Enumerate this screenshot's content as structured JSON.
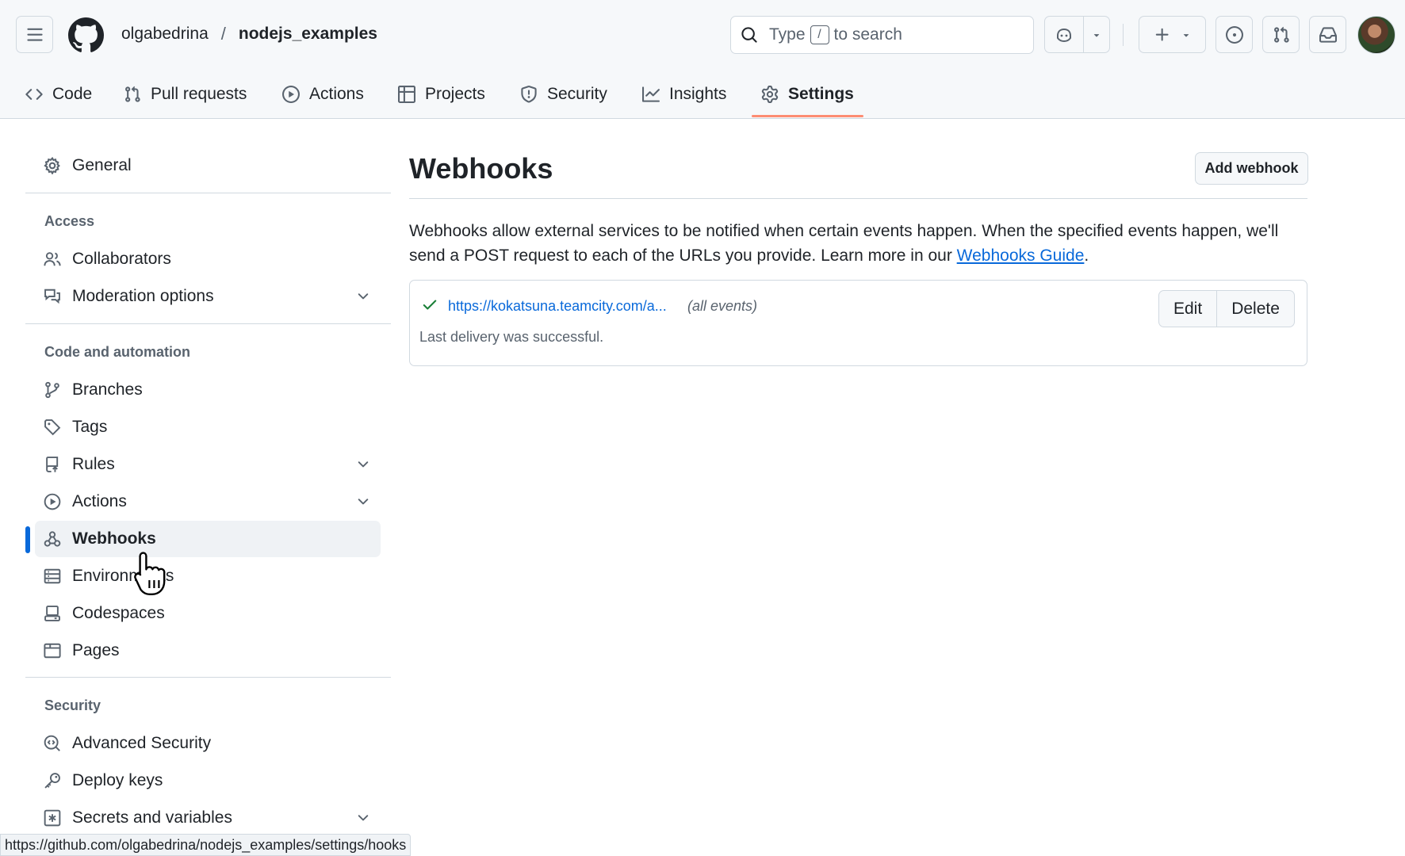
{
  "header": {
    "owner": "olgabedrina",
    "separator": "/",
    "repo": "nodejs_examples",
    "search": {
      "prefix": "Type",
      "key": "/",
      "suffix": "to search"
    }
  },
  "tabs": [
    {
      "label": "Code",
      "icon": "code-icon"
    },
    {
      "label": "Pull requests",
      "icon": "git-pull-request-icon"
    },
    {
      "label": "Actions",
      "icon": "play-icon"
    },
    {
      "label": "Projects",
      "icon": "table-icon"
    },
    {
      "label": "Security",
      "icon": "shield-icon"
    },
    {
      "label": "Insights",
      "icon": "graph-icon"
    },
    {
      "label": "Settings",
      "icon": "gear-icon",
      "active": true
    }
  ],
  "sidebar": {
    "general": "General",
    "groups": {
      "access": "Access",
      "code_automation": "Code and automation",
      "security": "Security"
    },
    "items": {
      "collaborators": "Collaborators",
      "moderation": "Moderation options",
      "branches": "Branches",
      "tags": "Tags",
      "rules": "Rules",
      "actions": "Actions",
      "webhooks": "Webhooks",
      "environments": "Environments",
      "codespaces": "Codespaces",
      "pages": "Pages",
      "advanced_security": "Advanced Security",
      "deploy_keys": "Deploy keys",
      "secrets": "Secrets and variables"
    }
  },
  "main": {
    "title": "Webhooks",
    "add_button": "Add webhook",
    "description_before": "Webhooks allow external services to be notified when certain events happen. When the specified events happen, we'll send a POST request to each of the URLs you provide. Learn more in our ",
    "guide_link": "Webhooks Guide",
    "description_after": ".",
    "webhook": {
      "url": "https://kokatsuna.teamcity.com/a...",
      "events": "(all events)",
      "status": "Last delivery was successful.",
      "edit": "Edit",
      "delete": "Delete"
    }
  },
  "statusbar": "https://github.com/olgabedrina/nodejs_examples/settings/hooks",
  "colors": {
    "accent": "#0969da",
    "tab_underline": "#fd8c73",
    "success": "#1a7f37",
    "header_bg": "#f6f8fa"
  }
}
